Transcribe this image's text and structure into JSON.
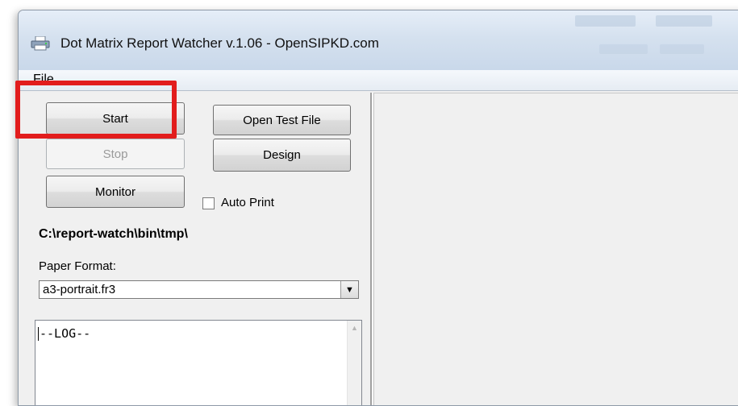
{
  "window": {
    "title": "Dot Matrix Report Watcher v.1.06 - OpenSIPKD.com",
    "icon": "printer-icon"
  },
  "menu": {
    "file": "File"
  },
  "controls": {
    "start": "Start",
    "stop": "Stop",
    "monitor": "Monitor",
    "open_test_file": "Open Test File",
    "design": "Design",
    "auto_print": {
      "label": "Auto Print",
      "checked": false
    }
  },
  "path": "C:\\report-watch\\bin\\tmp\\",
  "paper_format": {
    "label": "Paper Format:",
    "selected": "a3-portrait.fr3"
  },
  "log": {
    "text": "--LOG--"
  },
  "colors": {
    "highlight": "#e21d1d",
    "titlebar": "#d5e1ef",
    "window_bg": "#f0f0f0"
  }
}
